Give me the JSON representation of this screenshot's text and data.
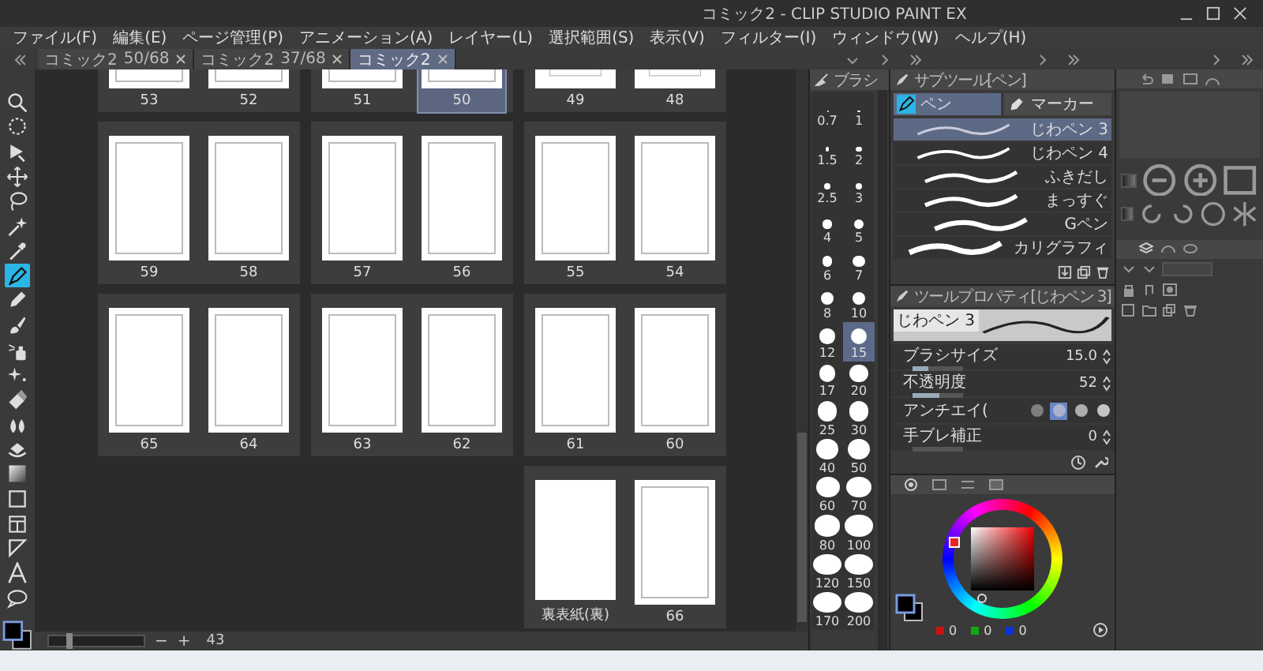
{
  "window": {
    "title": "コミック2 - CLIP STUDIO PAINT EX"
  },
  "menu": [
    "ファイル(F)",
    "編集(E)",
    "ページ管理(P)",
    "アニメーション(A)",
    "レイヤー(L)",
    "選択範囲(S)",
    "表示(V)",
    "フィルター(I)",
    "ウィンドウ(W)",
    "ヘルプ(H)"
  ],
  "tabs": [
    {
      "name": "コミック2",
      "pages": "50/68",
      "selected": false
    },
    {
      "name": "コミック2",
      "pages": "37/68",
      "selected": false
    },
    {
      "name": "コミック2",
      "selected": true
    }
  ],
  "tools": [
    {
      "selected": false
    },
    {
      "selected": false
    },
    {
      "selected": false
    },
    {
      "selected": false
    },
    {
      "selected": false
    },
    {
      "selected": false
    },
    {
      "selected": false
    },
    {
      "selected": true
    },
    {
      "selected": false
    },
    {
      "selected": false
    },
    {
      "selected": false
    },
    {
      "selected": false
    },
    {
      "selected": false
    },
    {
      "selected": false
    },
    {
      "selected": false
    },
    {
      "selected": false
    },
    {
      "selected": false
    },
    {
      "selected": false
    },
    {
      "selected": false
    },
    {
      "selected": false
    },
    {
      "selected": false
    }
  ],
  "spreads": [
    [
      {
        "pages": [
          {
            "label": "53",
            "kind": "blank",
            "selected": false
          },
          {
            "label": "52",
            "kind": "blank",
            "selected": false
          }
        ]
      },
      {
        "pages": [
          {
            "label": "51",
            "kind": "blank",
            "selected": false
          },
          {
            "label": "50",
            "kind": "blank",
            "selected": true
          }
        ]
      },
      {
        "pages": [
          {
            "label": "49",
            "kind": "sketch",
            "selected": false
          },
          {
            "label": "48",
            "kind": "sketch",
            "selected": false
          }
        ]
      }
    ],
    [
      {
        "pages": [
          {
            "label": "59",
            "kind": "blank",
            "selected": false
          },
          {
            "label": "58",
            "kind": "blank",
            "selected": false
          }
        ]
      },
      {
        "pages": [
          {
            "label": "57",
            "kind": "blank",
            "selected": false
          },
          {
            "label": "56",
            "kind": "blank",
            "selected": false
          }
        ]
      },
      {
        "pages": [
          {
            "label": "55",
            "kind": "blank",
            "selected": false
          },
          {
            "label": "54",
            "kind": "blank",
            "selected": false
          }
        ]
      }
    ],
    [
      {
        "pages": [
          {
            "label": "65",
            "kind": "blank",
            "selected": false
          },
          {
            "label": "64",
            "kind": "blank",
            "selected": false
          }
        ]
      },
      {
        "pages": [
          {
            "label": "63",
            "kind": "blank",
            "selected": false
          },
          {
            "label": "62",
            "kind": "blank",
            "selected": false
          }
        ]
      },
      {
        "pages": [
          {
            "label": "61",
            "kind": "blank",
            "selected": false
          },
          {
            "label": "60",
            "kind": "blank",
            "selected": false
          }
        ]
      }
    ],
    [
      {
        "pages": [
          {
            "label": "裏表紙(裏)",
            "kind": "cover",
            "selected": false
          },
          {
            "label": "66",
            "kind": "blank",
            "selected": false
          }
        ]
      }
    ]
  ],
  "status_bar": {
    "level": 0.2,
    "zoom_out": "−",
    "zoom_in": "+",
    "zoom": "43"
  },
  "brush_panel": {
    "title": "ブラシ",
    "sizes": [
      {
        "label": "0.7",
        "selected": false
      },
      {
        "label": "1",
        "selected": false
      },
      {
        "label": "1.5",
        "selected": false
      },
      {
        "label": "2",
        "selected": false
      },
      {
        "label": "2.5",
        "selected": false
      },
      {
        "label": "3",
        "selected": false
      },
      {
        "label": "4",
        "selected": false
      },
      {
        "label": "5",
        "selected": false
      },
      {
        "label": "6",
        "selected": false
      },
      {
        "label": "7",
        "selected": false
      },
      {
        "label": "8",
        "selected": false
      },
      {
        "label": "10",
        "selected": false
      },
      {
        "label": "12",
        "selected": false
      },
      {
        "label": "15",
        "selected": true
      },
      {
        "label": "17",
        "selected": false
      },
      {
        "label": "20",
        "selected": false
      },
      {
        "label": "25",
        "selected": false
      },
      {
        "label": "30",
        "selected": false
      },
      {
        "label": "40",
        "selected": false
      },
      {
        "label": "50",
        "selected": false
      },
      {
        "label": "60",
        "selected": false
      },
      {
        "label": "70",
        "selected": false
      },
      {
        "label": "80",
        "selected": false
      },
      {
        "label": "100",
        "selected": false
      },
      {
        "label": "120",
        "selected": false
      },
      {
        "label": "150",
        "selected": false
      },
      {
        "label": "170",
        "selected": false
      },
      {
        "label": "200",
        "selected": false
      }
    ]
  },
  "subtool": {
    "title": "サブツール[ペン]",
    "groups": [
      {
        "label": "ペン",
        "selected": true
      },
      {
        "label": "マーカー",
        "selected": false
      }
    ],
    "items": [
      {
        "label": "じわペン 3",
        "selected": true
      },
      {
        "label": "じわペン 4",
        "selected": false
      },
      {
        "label": "ふきだし",
        "selected": false
      },
      {
        "label": "まっすぐ",
        "selected": false
      },
      {
        "label": "Gペン",
        "selected": false
      },
      {
        "label": "カリグラフィ",
        "selected": false
      }
    ]
  },
  "tool_property": {
    "title": "ツールプロパティ[じわペン 3]",
    "preview_label": "じわペン 3",
    "rows": [
      {
        "kind": "slider",
        "label": "ブラシサイズ",
        "value": "15.0",
        "level": 0.3
      },
      {
        "kind": "slider",
        "label": "不透明度",
        "value": "52",
        "level": 0.52
      },
      {
        "kind": "choice",
        "label": "アンチエイ(",
        "options": [
          {
            "selected": false
          },
          {
            "selected": true
          },
          {
            "selected": false
          },
          {
            "selected": false
          }
        ]
      },
      {
        "kind": "slider",
        "label": "手ブレ補正",
        "value": "0",
        "level": 0
      }
    ]
  },
  "color": {
    "channels": [
      {
        "color": "#cc1111",
        "value": "0"
      },
      {
        "color": "#11aa11",
        "value": "0"
      },
      {
        "color": "#1133dd",
        "value": "0"
      }
    ]
  }
}
